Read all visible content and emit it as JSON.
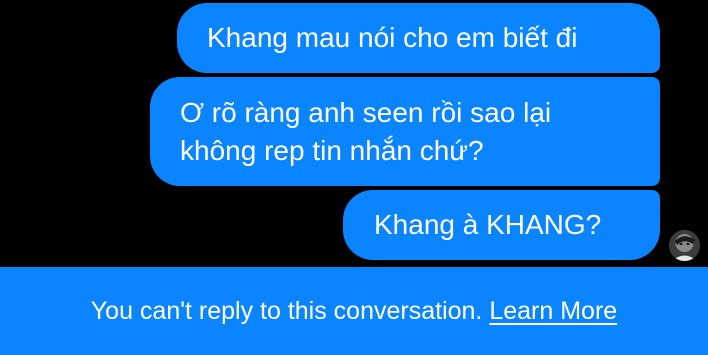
{
  "messages": [
    {
      "text": "Khang mau nói cho em biết đi"
    },
    {
      "text": "Ơ rõ ràng anh seen rồi sao lại\nkhông rep tin nhắn chứ?"
    },
    {
      "text": "Khang à KHANG?"
    }
  ],
  "footer": {
    "notice": "You can't reply to this conversation.",
    "link": "Learn More"
  },
  "colors": {
    "bubble": "#0a84ff",
    "background": "#000000",
    "text": "#ffffff"
  },
  "avatar": {
    "icon": "user-avatar"
  }
}
